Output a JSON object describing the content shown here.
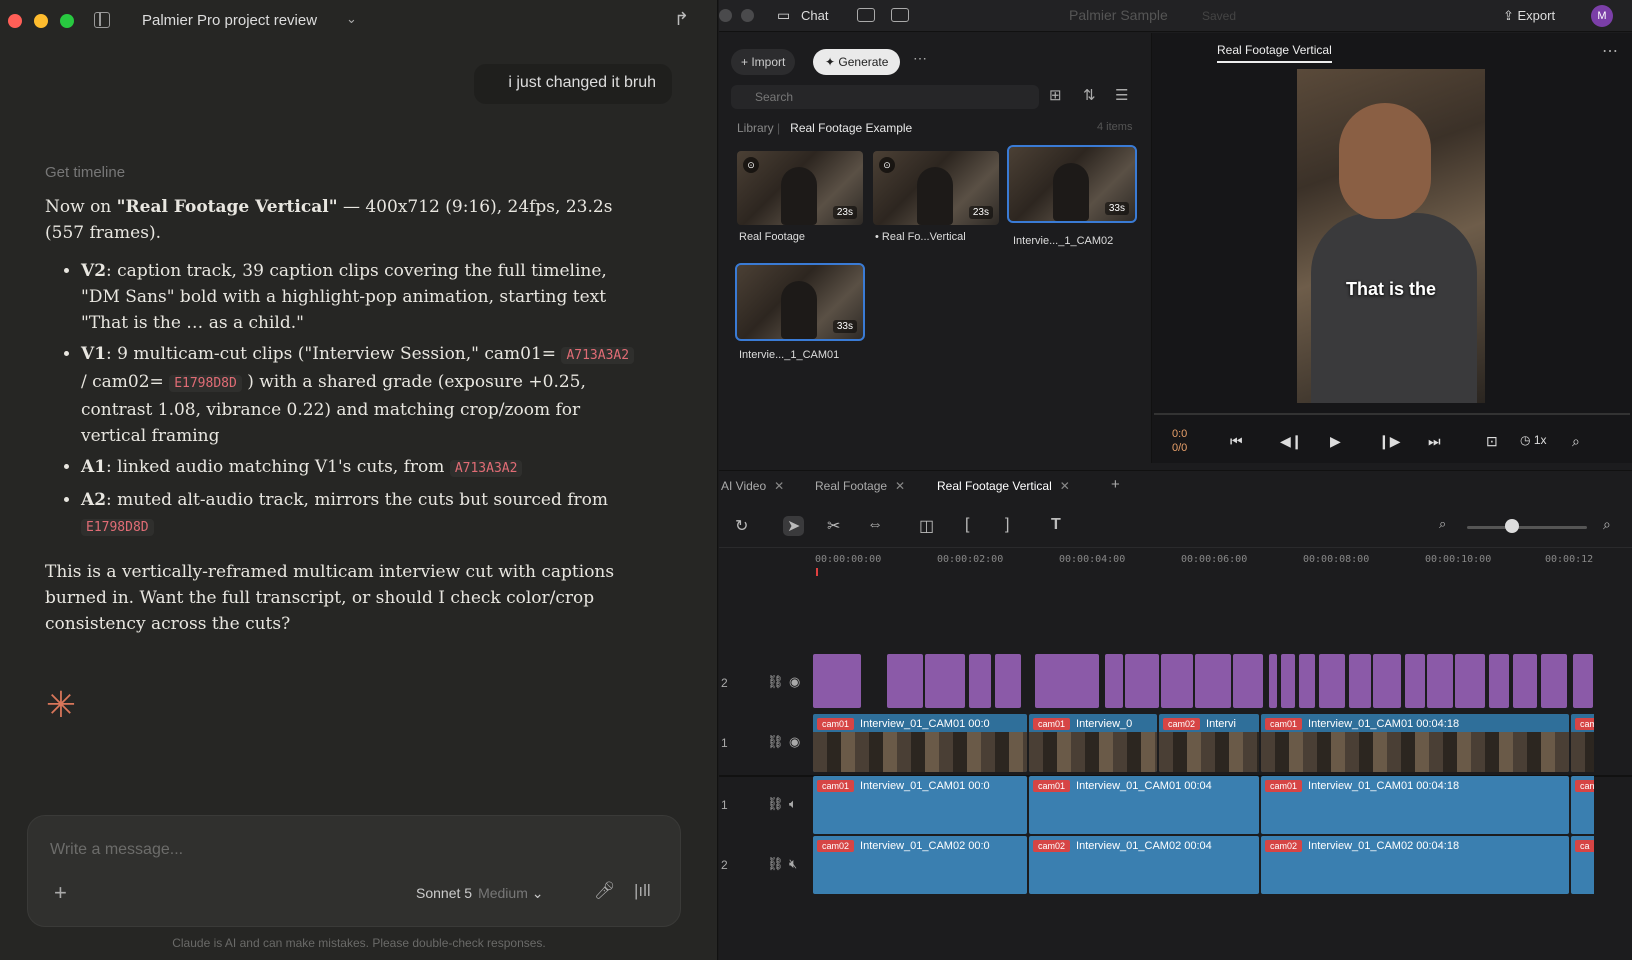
{
  "chat": {
    "project_title": "Palmier Pro project review",
    "user_message": "i just changed it bruh",
    "tool_label": "Get timeline",
    "intro_pre": "Now on ",
    "intro_bold": "\"Real Footage Vertical\"",
    "intro_post": " — 400x712 (9:16), 24fps, 23.2s (557 frames).",
    "bullets": [
      {
        "key": "V2",
        "text": ": caption track, 39 caption clips covering the full timeline, \"DM Sans\" bold with a highlight-pop animation, starting text \"That is the … as a child.\""
      },
      {
        "key": "V1",
        "text_a": ": 9 multicam-cut clips (\"Interview Session,\" cam01= ",
        "code_a": "A713A3A2",
        "text_b": " / cam02= ",
        "code_b": "E1798D8D",
        "text_c": " ) with a shared grade (exposure +0.25, contrast 1.08, vibrance 0.22) and matching crop/zoom for vertical framing"
      },
      {
        "key": "A1",
        "text_a": ": linked audio matching V1's cuts, from ",
        "code_a": "A713A3A2"
      },
      {
        "key": "A2",
        "text_a": ": muted alt-audio track, mirrors the cuts but sourced from ",
        "code_a": "E1798D8D"
      }
    ],
    "closing": "This is a vertically-reframed multicam interview cut with captions burned in. Want the full transcript, or should I check color/crop consistency across the cuts?",
    "composer_placeholder": "Write a message...",
    "model_name": "Sonnet 5",
    "model_effort": "Medium",
    "disclaimer": "Claude is AI and can make mistakes. Please double-check responses."
  },
  "editor": {
    "chat_label": "Chat",
    "app_title": "Palmier Sample",
    "app_sub": "Saved",
    "export_label": "Export",
    "avatar_initial": "M",
    "media": {
      "import_label": "+ Import",
      "generate_label": "Generate",
      "search_placeholder": "Search",
      "crumb_root": "Library",
      "crumb_current": "Real Footage Example",
      "count": "4 items",
      "items": [
        {
          "name": "Real Footage",
          "duration": "23s"
        },
        {
          "name": "• Real Fo...Vertical",
          "duration": "23s"
        },
        {
          "name": "Intervie..._1_CAM02",
          "duration": "33s"
        },
        {
          "name": "Intervie..._1_CAM01",
          "duration": "33s"
        }
      ]
    },
    "preview": {
      "tab_label": "Real Footage Vertical",
      "caption_text": "That is the",
      "timecode_a": "0:0",
      "timecode_b": "0/0",
      "speed": "1x"
    },
    "timeline": {
      "tabs": [
        "AI Video",
        "Real Footage",
        "Real Footage Vertical"
      ],
      "ruler": [
        "00:00:00:00",
        "00:00:02:00",
        "00:00:04:00",
        "00:00:06:00",
        "00:00:08:00",
        "00:00:10:00",
        "00:00:12"
      ],
      "track_numbers": [
        "2",
        "1",
        "1",
        "2"
      ],
      "v1_clips": [
        {
          "tag": "cam01",
          "label": "Interview_01_CAM01 00:0"
        },
        {
          "tag": "cam01",
          "label": "Interview_0"
        },
        {
          "tag": "cam02",
          "label": "Intervi"
        },
        {
          "tag": "cam01",
          "label": "Interview_01_CAM01 00:04:18"
        },
        {
          "tag": "cam",
          "label": ""
        }
      ],
      "a1_clips": [
        {
          "tag": "cam01",
          "label": "Interview_01_CAM01 00:0"
        },
        {
          "tag": "cam01",
          "label": "Interview_01_CAM01 00:04"
        },
        {
          "tag": "cam01",
          "label": "Interview_01_CAM01 00:04:18"
        },
        {
          "tag": "can",
          "label": ""
        }
      ],
      "a2_clips": [
        {
          "tag": "cam02",
          "label": "Interview_01_CAM02 00:0"
        },
        {
          "tag": "cam02",
          "label": "Interview_01_CAM02 00:04"
        },
        {
          "tag": "cam02",
          "label": "Interview_01_CAM02 00:04:18"
        },
        {
          "tag": "ca",
          "label": ""
        }
      ]
    }
  }
}
